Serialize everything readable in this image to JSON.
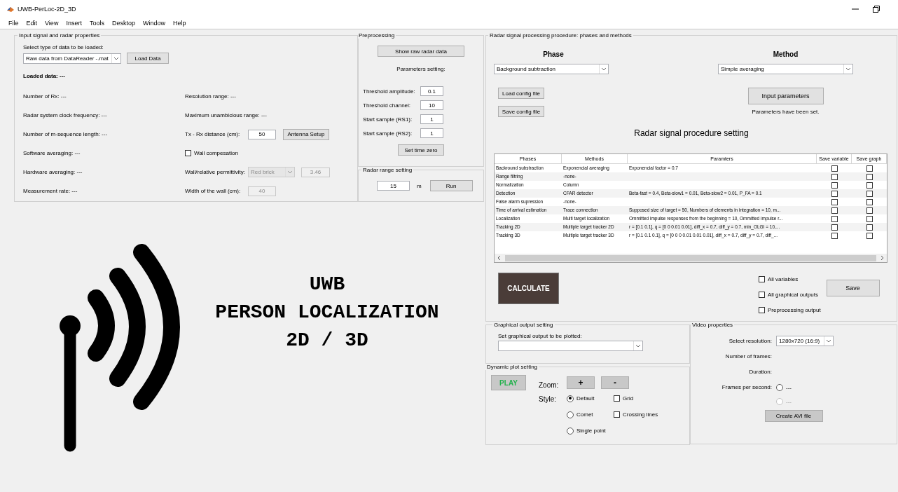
{
  "window": {
    "title": "UWB-PerLoc-2D_3D"
  },
  "menu": [
    "File",
    "Edit",
    "View",
    "Insert",
    "Tools",
    "Desktop",
    "Window",
    "Help"
  ],
  "input_panel": {
    "title": "Input signal and radar properties",
    "select_label": "Select type of data to be loaded:",
    "data_type": "Raw data from DataReader -.mat",
    "load_button": "Load Data",
    "loaded_data": "Loaded data: ---",
    "left_info": [
      "Number of Rx: ---",
      "Radar system clock frequency: ---",
      "Number of m-sequence length: ---",
      "Software averaging: ---",
      "Hardware averaging: ---",
      "Measurement rate: ---"
    ],
    "right_info": [
      {
        "kind": "text",
        "label": "Resolution range: ---"
      },
      {
        "kind": "text",
        "label": "Maximum unambicious range: ---"
      },
      {
        "kind": "input",
        "label": "Tx - Rx distance (cm):",
        "value": "50",
        "disabled": false,
        "button": "Antenna Setup"
      },
      {
        "kind": "checkbox",
        "label": "Wall compesation",
        "checked": false
      },
      {
        "kind": "select_input",
        "label": "Wall/relative permittivity:",
        "option": "Red brick",
        "value": "3.46",
        "disabled": true
      },
      {
        "kind": "input",
        "label": "Width of the wall (cm):",
        "value": "40",
        "disabled": true
      }
    ]
  },
  "preprocessing": {
    "title": "Preprocessing",
    "show_button": "Show raw radar data",
    "params_label": "Parameters setting:",
    "params": [
      {
        "label": "Threshold amplitude:",
        "value": "0.1"
      },
      {
        "label": "Threshold channel:",
        "value": "10"
      },
      {
        "label": "Start sample (RS1):",
        "value": "1"
      },
      {
        "label": "Start sample (RS2):",
        "value": "1"
      }
    ],
    "time_zero_button": "Set time zero"
  },
  "range": {
    "title": "Radar range setting",
    "value": "15",
    "unit": "m",
    "run_button": "Run"
  },
  "processing": {
    "title": "Radar signal processing procedure: phases and methods",
    "phase_heading": "Phase",
    "method_heading": "Method",
    "phase": "Background subtraction",
    "method": "Simple averaging",
    "load_config": "Load config file",
    "save_config": "Save config file",
    "input_button": "Input parameters",
    "status": "Parameters have been set.",
    "table_title": "Radar signal procedure setting",
    "table": {
      "columns": [
        "Phases",
        "Methods",
        "Paramters",
        "Save variable",
        "Save graph"
      ],
      "rows": [
        {
          "phase": "Backround substraction",
          "method": "Exponencial averaging",
          "params": "Exponencial factor = 0.7",
          "save_variable": false,
          "save_graph": false
        },
        {
          "phase": "Range filtring",
          "method": "-none-",
          "params": "",
          "save_variable": false,
          "save_graph": false
        },
        {
          "phase": "Normalization",
          "method": "Column",
          "params": "",
          "save_variable": false,
          "save_graph": false
        },
        {
          "phase": "Detection",
          "method": "CFAR detector",
          "params": "Beta-fast = 0.4, Beta-slow1 = 0.01, Beta-slow2 = 0.01, P_FA = 0.1",
          "save_variable": false,
          "save_graph": false
        },
        {
          "phase": "False alarm supression",
          "method": "-none-",
          "params": "",
          "save_variable": false,
          "save_graph": false
        },
        {
          "phase": "Time of arrival estimation",
          "method": "Trace connection",
          "params": "Supposed size of target = 50, Numbers of elements in integration = 10, m...",
          "save_variable": false,
          "save_graph": false
        },
        {
          "phase": "Localization",
          "method": "Multi target localization",
          "params": "Ommitted impulse responses from the beginning = 10, Ommitted impulse r...",
          "save_variable": false,
          "save_graph": false
        },
        {
          "phase": "Tracking 2D",
          "method": "Multiple target tracker 2D",
          "params": "r = [0.1 0.1], q = [0 0 0.01 0.01], diff_x = 0.7, diff_y = 0.7, min_OLGI = 10,...",
          "save_variable": false,
          "save_graph": false
        },
        {
          "phase": "Tracking 3D",
          "method": "Multiple target tracker 3D",
          "params": "r = [0.1 0.1 0.1], q = [0 0 0 0.01 0.01 0.01], diff_x = 0.7, diff_y = 0.7, diff_...",
          "save_variable": false,
          "save_graph": false
        }
      ]
    },
    "calculate_button": "CALCULATE",
    "save_options": [
      {
        "label": "All variables",
        "checked": false
      },
      {
        "label": "All graphical outputs",
        "checked": false
      },
      {
        "label": "Preprocessing output",
        "checked": false
      }
    ],
    "save_button": "Save"
  },
  "graphical": {
    "title": "Graphical output setting",
    "label": "Set graphical output to be plotted:"
  },
  "dynamic": {
    "title": "Dynamic plot setting",
    "play_button": "PLAY",
    "zoom_label": "Zoom:",
    "zoom_in": "+",
    "zoom_out": "-",
    "style_label": "Style:",
    "styles": [
      {
        "label": "Default",
        "selected": true
      },
      {
        "label": "Comet",
        "selected": false
      },
      {
        "label": "Single point",
        "selected": false
      }
    ],
    "options": [
      {
        "label": "Grid",
        "checked": false
      },
      {
        "label": "Crossing lines",
        "checked": false
      }
    ]
  },
  "video": {
    "title": "Video properties",
    "resolution_label": "Select resolution:",
    "resolution": "1280x720 (16:9)",
    "frames_label": "Number of frames:",
    "duration_label": "Duration:",
    "fps_label": "Frames per second:",
    "fps_options": [
      {
        "label": "---",
        "selected": false,
        "disabled": false
      },
      {
        "label": "---",
        "selected": false,
        "disabled": true
      }
    ],
    "create_button": "Create AVI file"
  },
  "logo": {
    "lines": [
      "UWB",
      "PERSON LOCALIZATION",
      "2D / 3D"
    ]
  }
}
